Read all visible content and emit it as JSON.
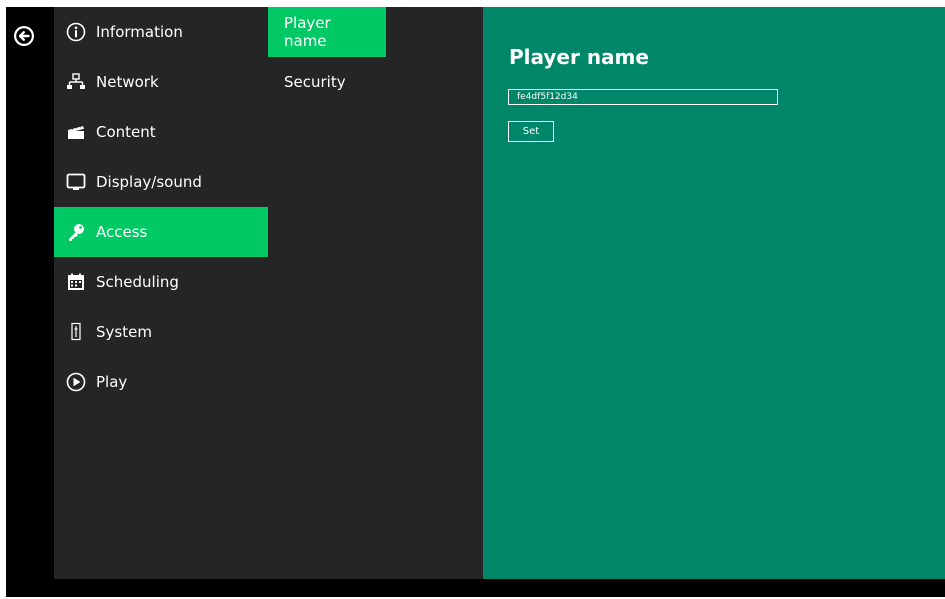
{
  "nav": {
    "back_icon": "back-arrow-icon",
    "items": [
      {
        "label": "Information",
        "icon": "info-icon"
      },
      {
        "label": "Network",
        "icon": "network-icon"
      },
      {
        "label": "Content",
        "icon": "clapperboard-icon"
      },
      {
        "label": "Display/sound",
        "icon": "monitor-icon"
      },
      {
        "label": "Access",
        "icon": "key-icon",
        "active": true
      },
      {
        "label": "Scheduling",
        "icon": "calendar-icon"
      },
      {
        "label": "System",
        "icon": "tuning-fork-icon"
      },
      {
        "label": "Play",
        "icon": "play-icon"
      }
    ]
  },
  "submenu": {
    "items": [
      {
        "label": "Player name",
        "active": true
      },
      {
        "label": "Security"
      }
    ]
  },
  "main": {
    "title": "Player name",
    "player_name_value": "fe4df5f12d34",
    "set_label": "Set"
  },
  "colors": {
    "accent": "#00c864",
    "panel": "#252525",
    "content": "#00876a"
  }
}
